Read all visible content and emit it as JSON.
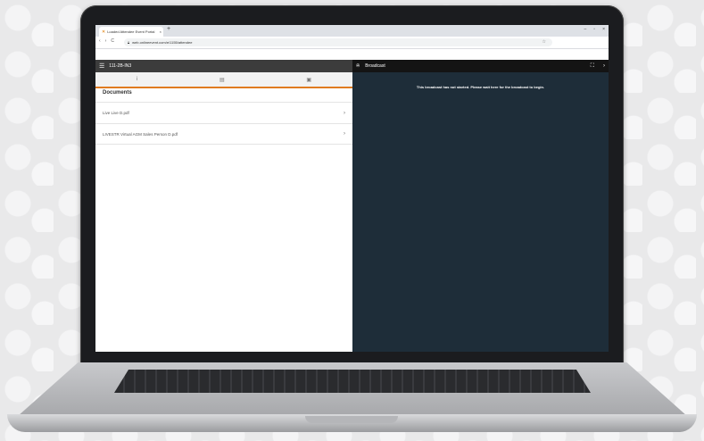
{
  "browser": {
    "tab_title": "Loaded Attendee Event Portal",
    "tab_favicon": "orange-x-icon",
    "new_tab": "+",
    "window_controls": [
      "–",
      "▫",
      "×"
    ],
    "url": "web.onlineevent.com/e/1155/attendee",
    "nav": [
      "‹",
      "›",
      "C"
    ]
  },
  "app": {
    "title": "111-2B-IN3",
    "tabs": [
      {
        "icon": "info-icon",
        "glyph": "i"
      },
      {
        "icon": "chat-icon",
        "glyph": "▤"
      },
      {
        "icon": "documents-icon",
        "glyph": "▣"
      }
    ],
    "documents_heading": "Documents",
    "documents": [
      {
        "name": "Live Live D.pdf"
      },
      {
        "name": "LIVESTR Virtual AGM Sales Person D.pdf"
      }
    ]
  },
  "broadcast": {
    "title": "Broadcast",
    "message": "This broadcast has not started. Please wait here for the broadcast to begin.",
    "controls": [
      "⛶",
      "›"
    ]
  },
  "colors": {
    "accent": "#e07b20",
    "broadcast_bg": "#1e2d39",
    "appbar_bg": "#3c3c3c"
  }
}
